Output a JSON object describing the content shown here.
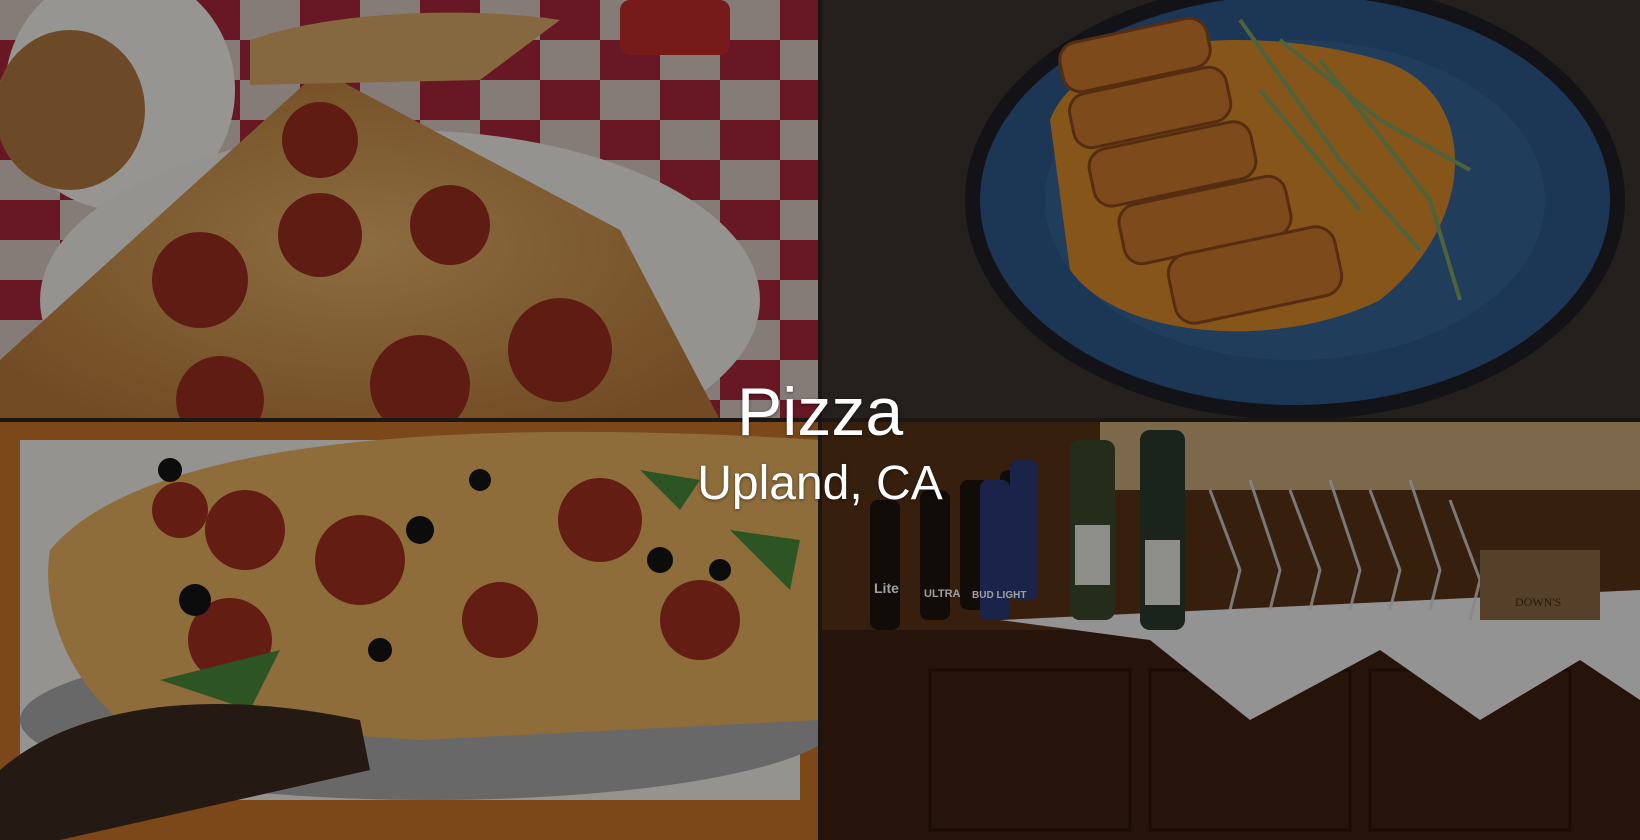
{
  "caption": {
    "title": "Pizza",
    "subtitle": "Upland, CA"
  },
  "photos": [
    {
      "subject": "pepperoni-pizza-slices"
    },
    {
      "subject": "crusted-pork-on-blue-plate"
    },
    {
      "subject": "supreme-pizza-on-tray"
    },
    {
      "subject": "drinks-table-with-bottles-and-glasses"
    }
  ],
  "bottle_labels": [
    "Lite",
    "ULTRA",
    "BUD LIGHT"
  ],
  "box_label": "DOWN'S",
  "colors": {
    "overlay": "rgba(0,0,0,0.38)",
    "caption_text": "#ffffff",
    "tablecloth_red": "#b0283a",
    "plate_blue": "#2e5a8a",
    "wood": "#5a3218"
  }
}
